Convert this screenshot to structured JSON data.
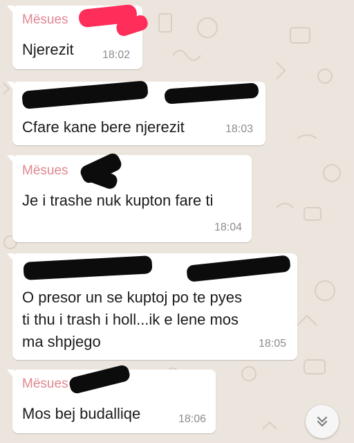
{
  "messages": [
    {
      "sender": "Mësues",
      "text": "Njerezit",
      "time": "18:02"
    },
    {
      "sender": "",
      "text": "Cfare kane bere njerezit",
      "time": "18:03"
    },
    {
      "sender": "Mësues",
      "text": "Je i trashe nuk kupton fare ti",
      "time": "18:04"
    },
    {
      "sender": "",
      "lines": [
        "O presor un se kuptoj po te pyes",
        "ti thu i trash i holl...ik  e lene mos",
        "ma shpjego"
      ],
      "time": "18:05"
    },
    {
      "sender": "Mësues",
      "text": "Mos bej budalliqe",
      "time": "18:06"
    }
  ],
  "colors": {
    "chat_background": "#ece5dd",
    "bubble": "#ffffff",
    "sender_name": "#e0878f",
    "redaction_red": "#ff2d5a",
    "redaction_black": "#0c0c0c",
    "timestamp": "#8c8c8c"
  },
  "icons": {
    "scroll_down": "double-chevron-down-icon"
  }
}
